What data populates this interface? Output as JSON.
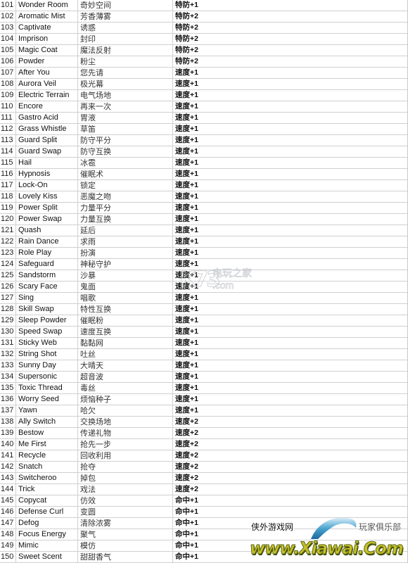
{
  "rows": [
    {
      "num": "101",
      "en": "Wonder Room",
      "zh": "奇妙空间",
      "effect": "特防+1"
    },
    {
      "num": "102",
      "en": "Aromatic Mist",
      "zh": "芳香薄雾",
      "effect": "特防+2"
    },
    {
      "num": "103",
      "en": "Captivate",
      "zh": "诱惑",
      "effect": "特防+2"
    },
    {
      "num": "104",
      "en": "Imprison",
      "zh": "封印",
      "effect": "特防+2"
    },
    {
      "num": "105",
      "en": "Magic Coat",
      "zh": "魔法反射",
      "effect": "特防+2"
    },
    {
      "num": "106",
      "en": "Powder",
      "zh": "粉尘",
      "effect": "特防+2"
    },
    {
      "num": "107",
      "en": "After You",
      "zh": "您先请",
      "effect": "速度+1"
    },
    {
      "num": "108",
      "en": "Aurora Veil",
      "zh": "极光幕",
      "effect": "速度+1"
    },
    {
      "num": "109",
      "en": "Electric Terrain",
      "zh": "电气场地",
      "effect": "速度+1"
    },
    {
      "num": "110",
      "en": "Encore",
      "zh": "再来一次",
      "effect": "速度+1"
    },
    {
      "num": "111",
      "en": "Gastro Acid",
      "zh": "胃液",
      "effect": "速度+1"
    },
    {
      "num": "112",
      "en": "Grass Whistle",
      "zh": "草笛",
      "effect": "速度+1"
    },
    {
      "num": "113",
      "en": "Guard Split",
      "zh": "防守平分",
      "effect": "速度+1"
    },
    {
      "num": "114",
      "en": "Guard Swap",
      "zh": "防守互换",
      "effect": "速度+1"
    },
    {
      "num": "115",
      "en": "Hail",
      "zh": "冰雹",
      "effect": "速度+1"
    },
    {
      "num": "116",
      "en": "Hypnosis",
      "zh": "催眠术",
      "effect": "速度+1"
    },
    {
      "num": "117",
      "en": "Lock-On",
      "zh": "锁定",
      "effect": "速度+1"
    },
    {
      "num": "118",
      "en": "Lovely Kiss",
      "zh": "恶魔之吻",
      "effect": "速度+1"
    },
    {
      "num": "119",
      "en": "Power Split",
      "zh": "力量平分",
      "effect": "速度+1"
    },
    {
      "num": "120",
      "en": "Power Swap",
      "zh": "力量互换",
      "effect": "速度+1"
    },
    {
      "num": "121",
      "en": "Quash",
      "zh": "延后",
      "effect": "速度+1"
    },
    {
      "num": "122",
      "en": "Rain Dance",
      "zh": "求雨",
      "effect": "速度+1"
    },
    {
      "num": "123",
      "en": "Role Play",
      "zh": "扮演",
      "effect": "速度+1"
    },
    {
      "num": "124",
      "en": "Safeguard",
      "zh": "神秘守护",
      "effect": "速度+1"
    },
    {
      "num": "125",
      "en": "Sandstorm",
      "zh": "沙暴",
      "effect": "速度+1"
    },
    {
      "num": "126",
      "en": "Scary Face",
      "zh": "鬼面",
      "effect": "速度+1"
    },
    {
      "num": "127",
      "en": "Sing",
      "zh": "唱歌",
      "effect": "速度+1"
    },
    {
      "num": "128",
      "en": "Skill Swap",
      "zh": "特性互换",
      "effect": "速度+1"
    },
    {
      "num": "129",
      "en": "Sleep Powder",
      "zh": "催眠粉",
      "effect": "速度+1"
    },
    {
      "num": "130",
      "en": "Speed Swap",
      "zh": "速度互换",
      "effect": "速度+1"
    },
    {
      "num": "131",
      "en": "Sticky Web",
      "zh": "黏黏网",
      "effect": "速度+1"
    },
    {
      "num": "132",
      "en": "String Shot",
      "zh": "吐丝",
      "effect": "速度+1"
    },
    {
      "num": "133",
      "en": "Sunny Day",
      "zh": "大晴天",
      "effect": "速度+1"
    },
    {
      "num": "134",
      "en": "Supersonic",
      "zh": "超音波",
      "effect": "速度+1"
    },
    {
      "num": "135",
      "en": "Toxic Thread",
      "zh": "毒丝",
      "effect": "速度+1"
    },
    {
      "num": "136",
      "en": "Worry Seed",
      "zh": "烦恼种子",
      "effect": "速度+1"
    },
    {
      "num": "137",
      "en": "Yawn",
      "zh": "哈欠",
      "effect": "速度+1"
    },
    {
      "num": "138",
      "en": "Ally Switch",
      "zh": "交换场地",
      "effect": "速度+2"
    },
    {
      "num": "139",
      "en": "Bestow",
      "zh": "传递礼物",
      "effect": "速度+2"
    },
    {
      "num": "140",
      "en": "Me First",
      "zh": "抢先一步",
      "effect": "速度+2"
    },
    {
      "num": "141",
      "en": "Recycle",
      "zh": "回收利用",
      "effect": "速度+2"
    },
    {
      "num": "142",
      "en": "Snatch",
      "zh": "抢夺",
      "effect": "速度+2"
    },
    {
      "num": "143",
      "en": "Switcheroo",
      "zh": "掉包",
      "effect": "速度+2"
    },
    {
      "num": "144",
      "en": "Trick",
      "zh": "戏法",
      "effect": "速度+2"
    },
    {
      "num": "145",
      "en": "Copycat",
      "zh": "仿效",
      "effect": "命中+1"
    },
    {
      "num": "146",
      "en": "Defense Curl",
      "zh": "变圆",
      "effect": "命中+1"
    },
    {
      "num": "147",
      "en": "Defog",
      "zh": "清除浓雾",
      "effect": "命中+1"
    },
    {
      "num": "148",
      "en": "Focus Energy",
      "zh": "聚气",
      "effect": "命中+1"
    },
    {
      "num": "149",
      "en": "Mimic",
      "zh": "模仿",
      "effect": "命中+1"
    },
    {
      "num": "150",
      "en": "Sweet Scent",
      "zh": "甜甜香气",
      "effect": "命中+1"
    }
  ],
  "watermarks": {
    "k73": {
      "logo": "K73",
      "site_name": "电玩之家",
      "domain": ".com"
    },
    "xiawai": {
      "left_text": "侠外游戏网",
      "right_text": "玩家俱乐部",
      "url": "www.Xiawai.Com"
    }
  }
}
